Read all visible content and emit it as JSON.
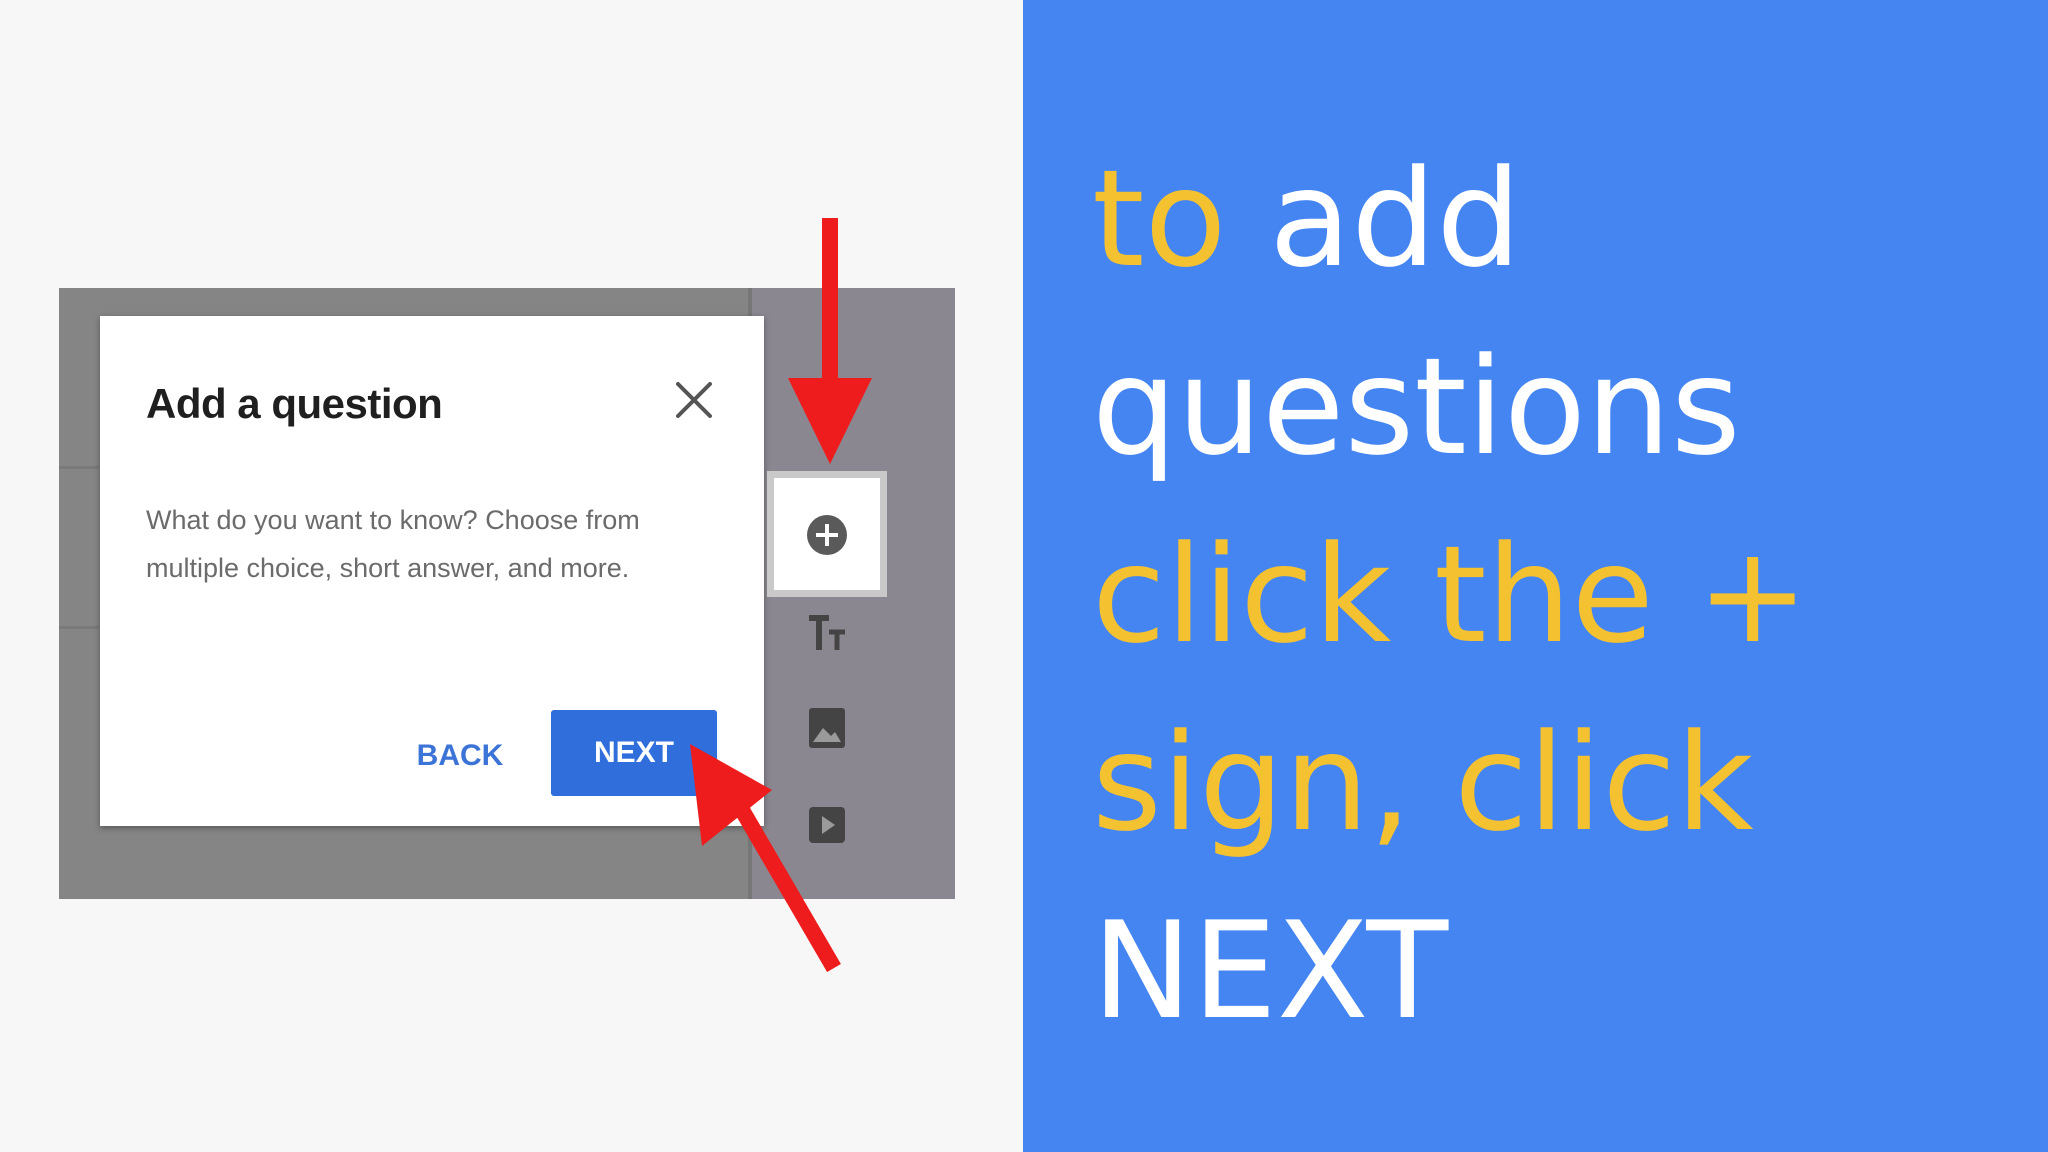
{
  "dialog": {
    "title": "Add a question",
    "description": "What do you want to know? Choose from multiple choice, short answer, and more.",
    "back_label": "BACK",
    "next_label": "NEXT"
  },
  "toolbar": {
    "icons": [
      "add-question-icon",
      "title-text-icon",
      "image-icon",
      "video-icon"
    ]
  },
  "caption": {
    "line1_yellow": "to",
    "line1_white": "add",
    "line2_white": "questions",
    "line3_yellow": "click the +",
    "line4_yellow": "sign, click",
    "line5_white": "NEXT"
  },
  "colors": {
    "panel_blue": "#4585f2",
    "caption_yellow": "#f4c131",
    "arrow_red": "#ee1c1c",
    "button_blue": "#2f6edb"
  }
}
